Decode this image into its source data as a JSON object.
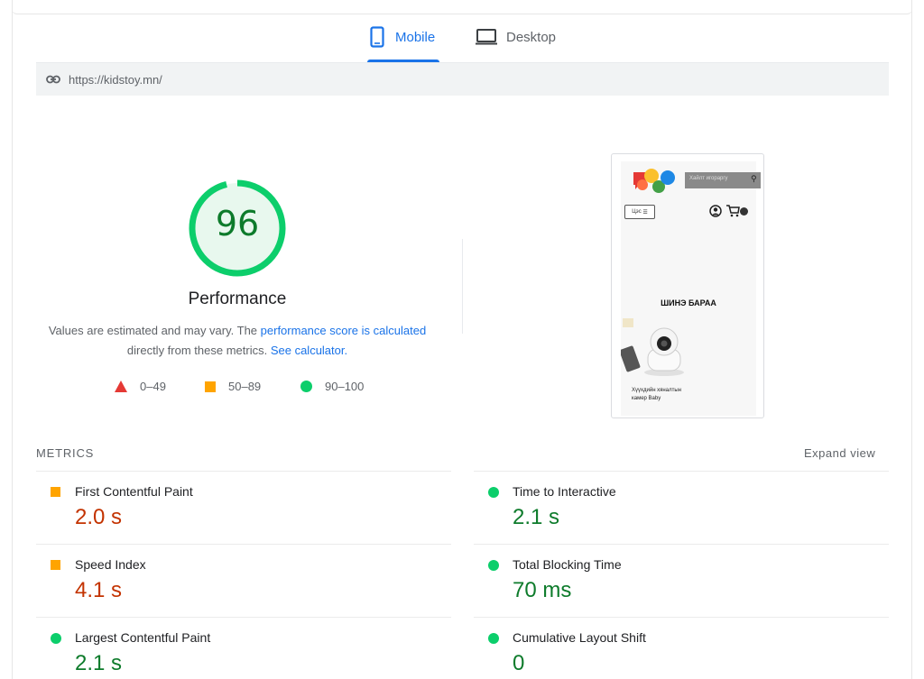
{
  "tabs": [
    {
      "label": "Mobile",
      "icon": "phone-icon",
      "active": true
    },
    {
      "label": "Desktop",
      "icon": "laptop-icon",
      "active": false
    }
  ],
  "url": "https://kidstoy.mn/",
  "score": {
    "value": "96",
    "title": "Performance",
    "desc_prefix": "Values are estimated and may vary. The ",
    "desc_link1": "performance score is calculated",
    "desc_mid": "directly from these metrics. ",
    "desc_link2": "See calculator.",
    "color": "#0cce6b"
  },
  "legend": [
    {
      "range": "0–49",
      "shape": "triangle",
      "color": "#e53935"
    },
    {
      "range": "50–89",
      "shape": "square",
      "color": "#ffa400"
    },
    {
      "range": "90–100",
      "shape": "circle",
      "color": "#0cce6b"
    }
  ],
  "thumbnail": {
    "search_placeholder": "Хайлт игораргу",
    "menu_label": "Цэс",
    "section_title": "ШИНЭ БАРАА",
    "product_name": "Хүүхдийн хяналтын камер Baby"
  },
  "metrics": {
    "title": "METRICS",
    "expand_label": "Expand view",
    "items": [
      {
        "label": "First Contentful Paint",
        "value": "2.0 s",
        "status": "average"
      },
      {
        "label": "Time to Interactive",
        "value": "2.1 s",
        "status": "good"
      },
      {
        "label": "Speed Index",
        "value": "4.1 s",
        "status": "average"
      },
      {
        "label": "Total Blocking Time",
        "value": "70 ms",
        "status": "good"
      },
      {
        "label": "Largest Contentful Paint",
        "value": "2.1 s",
        "status": "good"
      },
      {
        "label": "Cumulative Layout Shift",
        "value": "0",
        "status": "good"
      }
    ]
  }
}
